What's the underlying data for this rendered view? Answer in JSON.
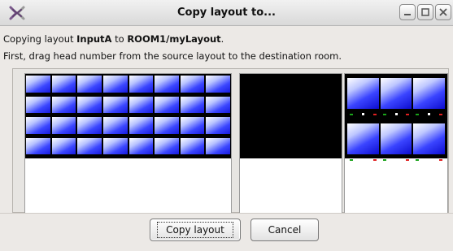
{
  "window": {
    "title": "Copy layout to...",
    "icon": "x-logo-icon",
    "controls": [
      "minimize-icon",
      "maximize-icon",
      "close-icon"
    ]
  },
  "message": {
    "line1_prefix": "Copying layout ",
    "layout_name": "InputA",
    "line1_middle": " to ",
    "destination": "ROOM1/myLayout",
    "line1_suffix": ".",
    "line2": "First, drag head number from the source layout to the destination room."
  },
  "buttons": {
    "copy_label": "Copy layout",
    "cancel_label": "Cancel"
  },
  "colors": {
    "thumb_blue": "#2a35ff",
    "marker_green": "#1aa31a",
    "marker_red": "#e02020"
  }
}
